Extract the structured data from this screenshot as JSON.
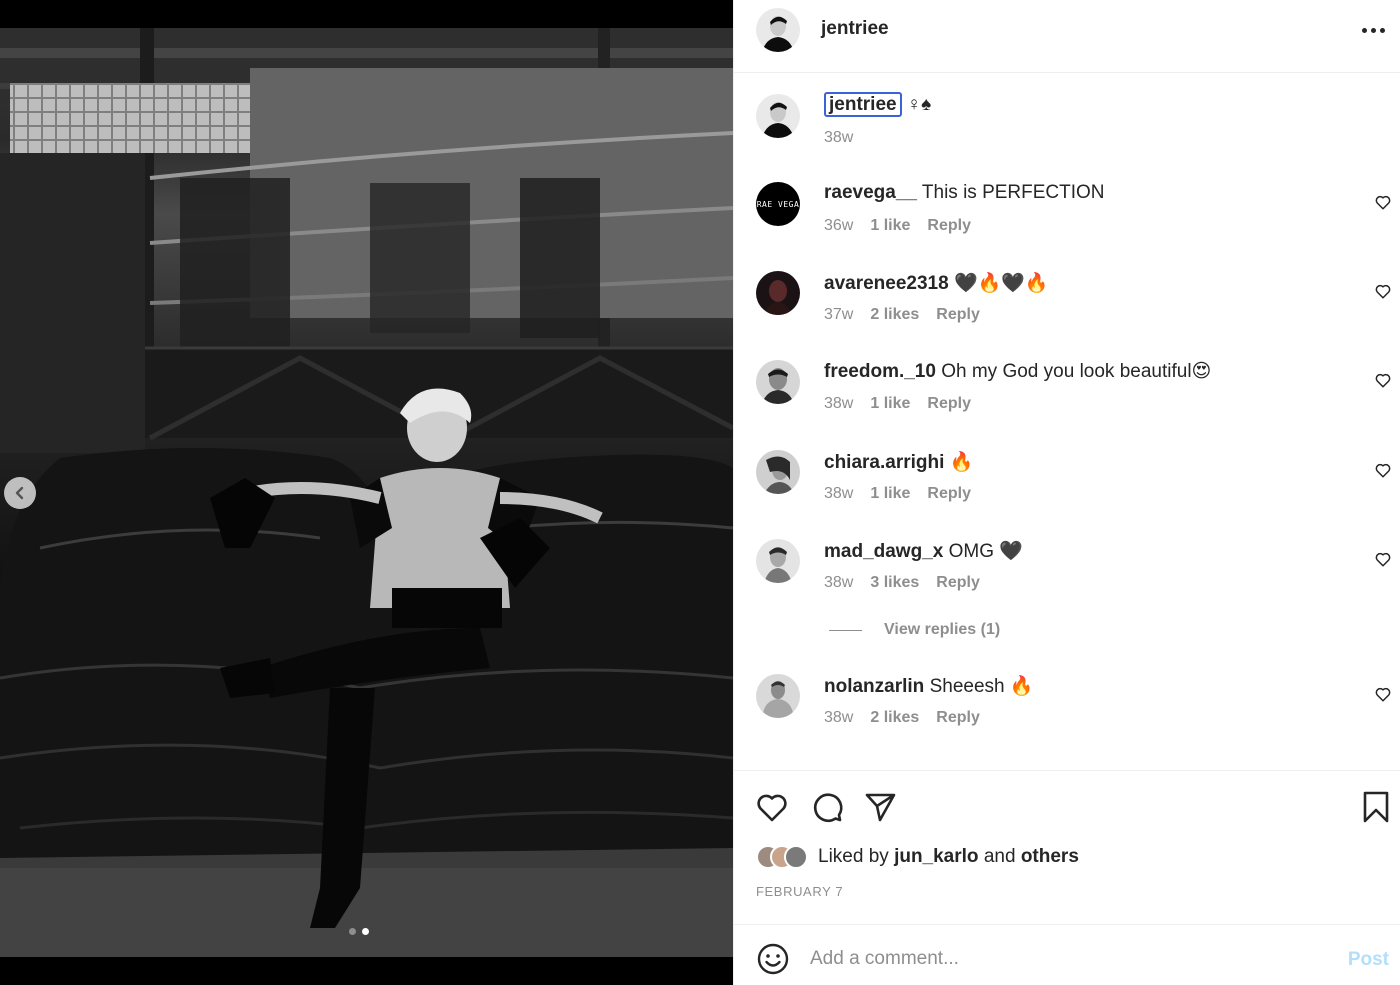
{
  "post": {
    "username": "jentriee",
    "caption_suffix": "♀♠",
    "caption_time": "38w",
    "carousel": {
      "slide_count": 2,
      "active_slide": 2
    }
  },
  "comments": [
    {
      "user": "raevega__",
      "text": "This is PERFECTION",
      "time": "36w",
      "likes": "1 like",
      "reply": "Reply",
      "avatar_text": "RAE VEGA"
    },
    {
      "user": "avarenee2318",
      "text": "🖤🔥🖤🔥",
      "time": "37w",
      "likes": "2 likes",
      "reply": "Reply"
    },
    {
      "user": "freedom._10",
      "text": "Oh my God you look beautiful😍",
      "time": "38w",
      "likes": "1 like",
      "reply": "Reply"
    },
    {
      "user": "chiara.arrighi",
      "text": "🔥",
      "time": "38w",
      "likes": "1 like",
      "reply": "Reply"
    },
    {
      "user": "mad_dawg_x",
      "text": "OMG 🖤",
      "time": "38w",
      "likes": "3 likes",
      "reply": "Reply",
      "view_replies": "View replies (1)"
    },
    {
      "user": "nolanzarlin",
      "text": "Sheeesh 🔥",
      "time": "38w",
      "likes": "2 likes",
      "reply": "Reply"
    }
  ],
  "likes": {
    "prefix": "Liked by",
    "user": "jun_karlo",
    "middle": "and",
    "others": "others"
  },
  "date": "FEBRUARY 7",
  "composer": {
    "placeholder": "Add a comment...",
    "post_label": "Post"
  },
  "icons": {
    "more": "more-options-icon",
    "like": "heart-icon",
    "comment": "comment-icon",
    "share": "paper-plane-icon",
    "save": "bookmark-icon",
    "emoji": "emoji-icon",
    "prev": "chevron-left-icon"
  },
  "colors": {
    "focus_ring": "#3b62d8",
    "post_disabled": "#b2dffc",
    "meta_text": "#8e8e8e"
  }
}
